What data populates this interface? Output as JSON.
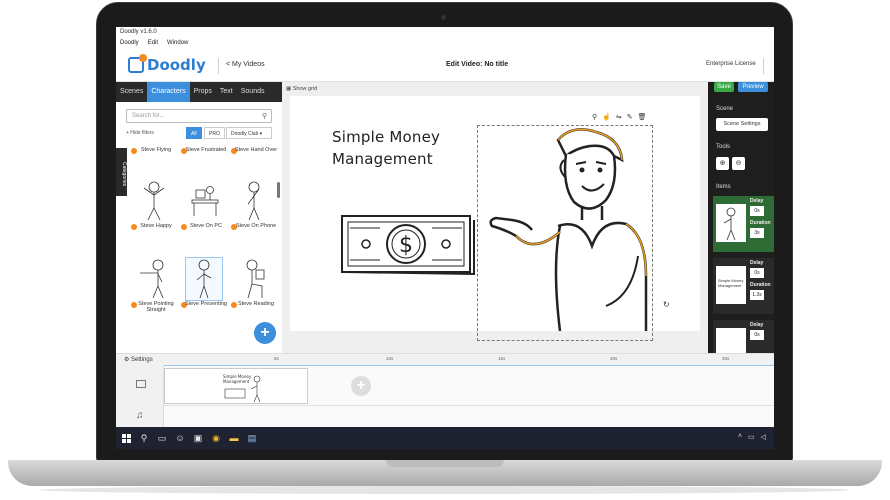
{
  "window": {
    "title": "Doodly v1.6.0"
  },
  "menu": [
    "Doodly",
    "Edit",
    "Window"
  ],
  "header": {
    "brand": "Doodly",
    "my_videos": "< My Videos",
    "video_title": "Edit Video: No title",
    "license": "Enterprise License"
  },
  "tabs": [
    "Scenes",
    "Characters",
    "Props",
    "Text",
    "Sounds"
  ],
  "active_tab": "Characters",
  "search": {
    "placeholder": "Search for..."
  },
  "filters": {
    "hide": "+ Hide filters",
    "all": "All",
    "pro": "PRO",
    "club": "Doodly Club ▾"
  },
  "categories_tab": "Categories",
  "characters": [
    {
      "label": "Steve Flying",
      "pro": true
    },
    {
      "label": "Steve Frustrated",
      "pro": true
    },
    {
      "label": "Steve Hand Over",
      "pro": true
    },
    {
      "label": "Steve Happy",
      "pro": true
    },
    {
      "label": "Steve On PC",
      "pro": true
    },
    {
      "label": "Steve On Phone",
      "pro": true
    },
    {
      "label": "Steve Pointing Straight",
      "pro": true
    },
    {
      "label": "Steve Presenting",
      "pro": true
    },
    {
      "label": "Steve Reading",
      "pro": true
    }
  ],
  "canvas": {
    "show_grid": "Show grid",
    "title_line1": "Simple Money",
    "title_line2": "Management"
  },
  "right_panel": {
    "save": "Save",
    "preview": "Preview",
    "scene_label": "Scene",
    "scene_settings": "Scene Settings",
    "tools_label": "Tools",
    "items_label": "Items",
    "items": [
      {
        "delay_label": "Delay",
        "delay": "0s",
        "duration_label": "Duration",
        "duration": "3s"
      },
      {
        "delay_label": "Delay",
        "delay": "0s",
        "duration_label": "Duration",
        "duration": "1.3s"
      },
      {
        "delay_label": "Delay",
        "delay": "0s",
        "duration_label": "",
        "duration": ""
      }
    ]
  },
  "timeline": {
    "settings": "Settings",
    "ruler": [
      "5s",
      "10s",
      "15s",
      "20s",
      "25s"
    ]
  },
  "colors": {
    "brand_blue": "#3b8fdc",
    "save_green": "#3aaa49",
    "pro_orange": "#f58a1f",
    "dark_panel": "#1e1e1e"
  }
}
